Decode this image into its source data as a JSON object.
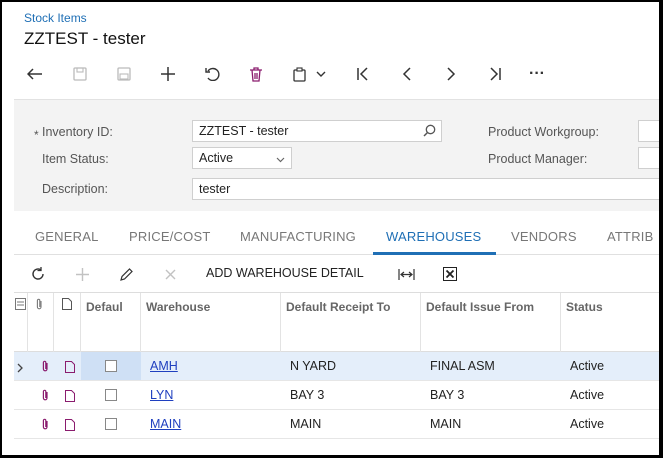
{
  "breadcrumb": "Stock Items",
  "title": "ZZTEST - tester",
  "toolbar": {
    "icons": [
      "back-icon",
      "save-close-icon",
      "save-icon",
      "add-icon",
      "undo-icon",
      "delete-icon",
      "copy-paste-icon",
      "chevron-down-icon",
      "first-record-icon",
      "previous-record-icon",
      "next-record-icon",
      "last-record-icon",
      "more-icon"
    ],
    "more_label": "···"
  },
  "summary": {
    "required_mark": "*",
    "inventory_id_label": "Inventory ID:",
    "inventory_id_value": "ZZTEST - tester",
    "item_status_label": "Item Status:",
    "item_status_value": "Active",
    "description_label": "Description:",
    "description_value": "tester",
    "product_workgroup_label": "Product Workgroup:",
    "product_manager_label": "Product Manager:"
  },
  "tabs": [
    "GENERAL",
    "PRICE/COST",
    "MANUFACTURING",
    "WAREHOUSES",
    "VENDORS",
    "ATTRIB"
  ],
  "active_tab": "WAREHOUSES",
  "grid_toolbar": {
    "add_warehouse_detail_label": "ADD WAREHOUSE DETAIL"
  },
  "grid": {
    "columns": [
      "Defaul",
      "Warehouse",
      "Default Receipt To",
      "Default Issue From",
      "Status"
    ],
    "rows": [
      {
        "warehouse": "AMH",
        "receipt_to": "N YARD",
        "issue_from": "FINAL ASM",
        "status": "Active",
        "selected": true
      },
      {
        "warehouse": "LYN",
        "receipt_to": "BAY 3",
        "issue_from": "BAY 3",
        "status": "Active",
        "selected": false
      },
      {
        "warehouse": "MAIN",
        "receipt_to": "MAIN",
        "issue_from": "MAIN",
        "status": "Active",
        "selected": false
      }
    ]
  },
  "colors": {
    "accent": "#1f6fb5",
    "link": "#1f3fbf",
    "selected_row": "#e4eefa"
  }
}
